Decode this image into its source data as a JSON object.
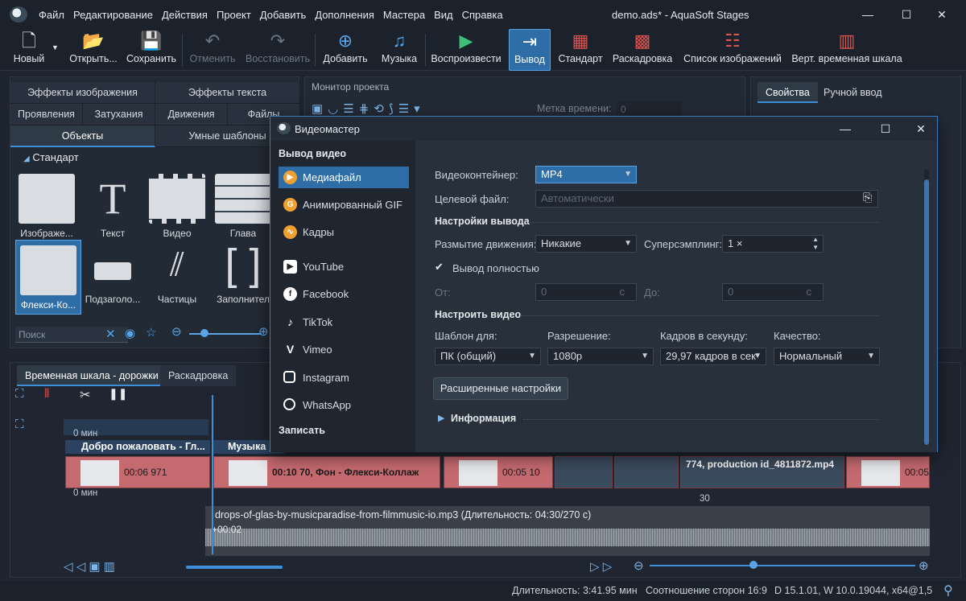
{
  "app": {
    "window_title": "demo.ads* - AquaSoft Stages",
    "menu": [
      "Файл",
      "Редактирование",
      "Действия",
      "Проект",
      "Добавить",
      "Дополнения",
      "Мастера",
      "Вид",
      "Справка"
    ]
  },
  "toolbar": {
    "new": "Новый",
    "open": "Открыть...",
    "save": "Сохранить",
    "undo": "Отменить",
    "redo": "Восстановить",
    "add": "Добавить",
    "music": "Музыка",
    "play": "Воспроизвести",
    "output": "Вывод",
    "standard": "Стандарт",
    "storyboard": "Раскадровка",
    "image_list": "Список изображений",
    "vertical_timeline": "Верт. временная шкала"
  },
  "left_panel": {
    "tabs_row1": [
      "Эффекты изображения",
      "Эффекты текста"
    ],
    "tabs_row2": [
      "Проявления",
      "Затухания",
      "Движения",
      "Файлы"
    ],
    "tabs_row3": [
      "Объекты",
      "Умные шаблоны"
    ],
    "section": "Стандарт",
    "objects": [
      "Изображе...",
      "Текст",
      "Видео",
      "Глава",
      "Флекси-Ко...",
      "Подзаголо...",
      "Частицы",
      "Заполнител"
    ],
    "search_placeholder": "Поиск"
  },
  "monitor": {
    "title": "Монитор проекта",
    "marker_label": "Метка времени:",
    "marker_value": "0"
  },
  "right_panel": {
    "tab_properties": "Свойства",
    "tab_manual": "Ручной ввод"
  },
  "timeline": {
    "tab_tracks": "Временная шкала - дорожки",
    "tab_storyboard": "Раскадровка",
    "ruler_min": "0 мин",
    "ruler_30": "30",
    "chapter1": "Добро пожаловать - Гл...",
    "chapter2": "Музыка",
    "clip1": "00:06 971",
    "clip2": "00:10 70, Фон - Флекси-Коллаж",
    "clip3": "00:05 10",
    "clip4": "774, production id_4811872.mp4",
    "clip5": "00:05",
    "audio_label": "drops-of-glas-by-musicparadise-from-filmmusic-io.mp3 (Длительность: 04:30/270 с)",
    "audio_time": "+00:02"
  },
  "status": {
    "duration": "Длительность: 3:41.95 мин",
    "ratio": "Соотношение сторон 16:9",
    "version": "D 15.1.01, W 10.0.19044, x64@1,5"
  },
  "dialog": {
    "title": "Видеомастер",
    "nav_head_video": "Вывод видео",
    "nav_items": [
      "Медиафайл",
      "Анимированный GIF",
      "Кадры"
    ],
    "nav_social": [
      "YouTube",
      "Facebook",
      "TikTok",
      "Vimeo",
      "Instagram",
      "WhatsApp"
    ],
    "nav_head_record": "Записать",
    "container_label": "Видеоконтейнер:",
    "container_value": "MP4",
    "target_label": "Целевой файл:",
    "target_placeholder": "Автоматически",
    "output_settings": "Настройки вывода",
    "motion_blur_label": "Размытие движения:",
    "motion_blur_value": "Никакие",
    "supersampling_label": "Суперсэмплинг:",
    "supersampling_value": "1 ×",
    "full_output": "Вывод полностью",
    "from_label": "От:",
    "from_value": "0",
    "to_label": "До:",
    "to_value": "0",
    "unit": "с",
    "video_settings": "Настроить видео",
    "template_label": "Шаблон для:",
    "template_value": "ПК (общий)",
    "resolution_label": "Разрешение:",
    "resolution_value": "1080p",
    "fps_label": "Кадров в секунду:",
    "fps_value": "29,97 кадров в сек",
    "quality_label": "Качество:",
    "quality_value": "Нормальный",
    "advanced": "Расширенные настройки",
    "info": "Информация"
  }
}
